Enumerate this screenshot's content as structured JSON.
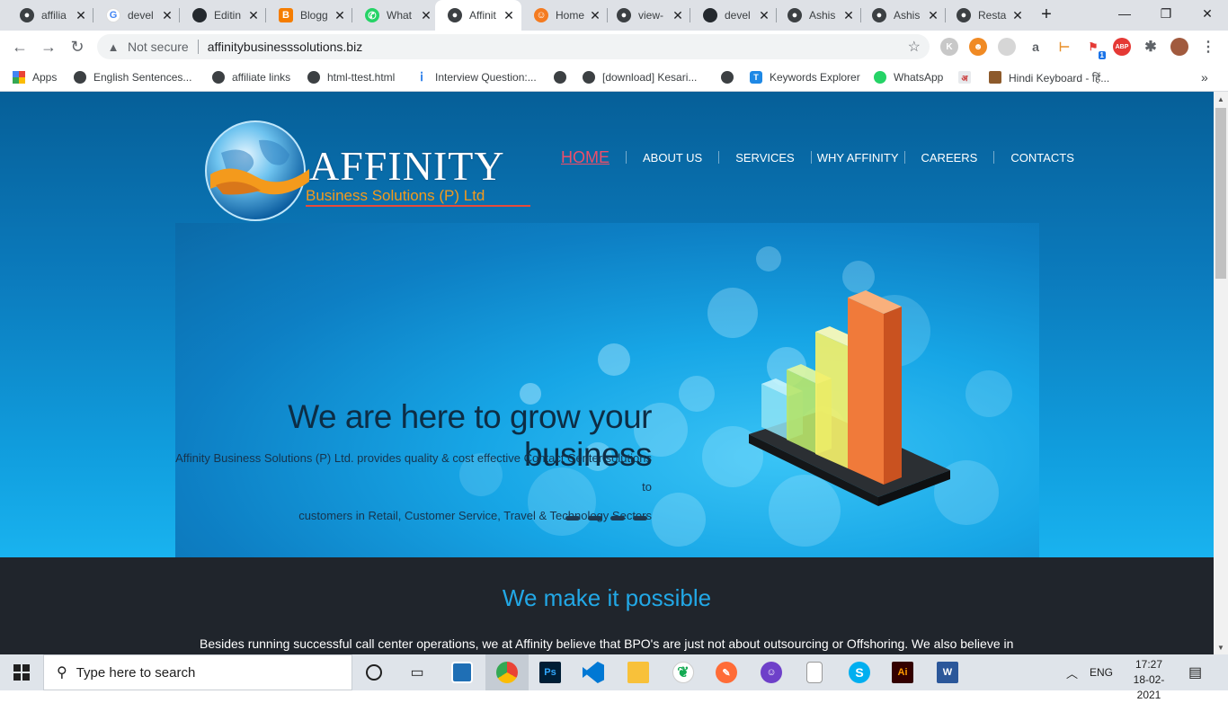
{
  "browser": {
    "tabs": [
      {
        "title": "affilia",
        "icon": "globe-icon",
        "color": "#3c4043"
      },
      {
        "title": "devel",
        "icon": "google-icon",
        "color": "#4285f4"
      },
      {
        "title": "Editin",
        "icon": "github-icon",
        "color": "#24292e"
      },
      {
        "title": "Blogg",
        "icon": "blogger-icon",
        "color": "#f57d00"
      },
      {
        "title": "What",
        "icon": "whatsapp-icon",
        "color": "#25d366"
      },
      {
        "title": "Affinit",
        "icon": "globe-icon",
        "color": "#3c4043",
        "active": true
      },
      {
        "title": "Home",
        "icon": "person-icon",
        "color": "#f47b20"
      },
      {
        "title": "view-",
        "icon": "globe-icon",
        "color": "#3c4043"
      },
      {
        "title": "devel",
        "icon": "github-icon",
        "color": "#24292e"
      },
      {
        "title": "Ashis",
        "icon": "globe-icon",
        "color": "#3c4043"
      },
      {
        "title": "Ashis",
        "icon": "globe-icon",
        "color": "#3c4043"
      },
      {
        "title": "Resta",
        "icon": "globe-icon",
        "color": "#3c4043"
      }
    ],
    "new_tab": "+",
    "address": {
      "security_label": "Not secure",
      "url": "affinitybusinesssolutions.biz"
    },
    "bookmarks": [
      {
        "label": "Apps"
      },
      {
        "label": "English Sentences..."
      },
      {
        "label": "affiliate links"
      },
      {
        "label": "html-ttest.html"
      },
      {
        "label": "Interview Question:..."
      },
      {
        "label": ""
      },
      {
        "label": "[download] Kesari..."
      },
      {
        "label": ""
      },
      {
        "label": "Keywords Explorer"
      },
      {
        "label": "WhatsApp"
      },
      {
        "label": ""
      },
      {
        "label": "Hindi Keyboard - हिं..."
      }
    ],
    "bookmarks_more": "»",
    "extension_badge": "1",
    "abp_label": "ABP"
  },
  "site": {
    "logo": {
      "word": "AFFINITY",
      "tagline": "Business Solutions (P) Ltd"
    },
    "nav": [
      "HOME",
      "ABOUT US",
      "SERVICES",
      "WHY AFFINITY",
      "CAREERS",
      "CONTACTS"
    ],
    "hero": {
      "title": "We are here to grow your business",
      "subtitle_line1": "Affinity Business Solutions (P) Ltd. provides quality & cost effective Contact Center solutions to",
      "subtitle_line2": "customers in Retail, Customer Service, Travel & Technology Sectors",
      "slides": 4
    },
    "section": {
      "heading": "We make it possible",
      "text": "Besides running successful call center operations, we at Affinity believe that BPO's are just not about outsourcing or Offshoring. We also believe in"
    },
    "colors": {
      "accent": "#22a8e6",
      "nav_active": "#ee4e6a",
      "logo_orange": "#f49a1c"
    }
  },
  "taskbar": {
    "search_placeholder": "Type here to search",
    "apps": [
      "cortana",
      "task-view",
      "app-button",
      "chrome",
      "photoshop",
      "vscode",
      "file-explorer",
      "mongodb",
      "postman",
      "github-desktop",
      "notepad",
      "skype",
      "illustrator",
      "word"
    ],
    "photoshop_label": "Ps",
    "illustrator_label": "Ai",
    "skype_label": "S",
    "word_label": "W",
    "language": "ENG",
    "time": "17:27",
    "date": "18-02-2021"
  }
}
